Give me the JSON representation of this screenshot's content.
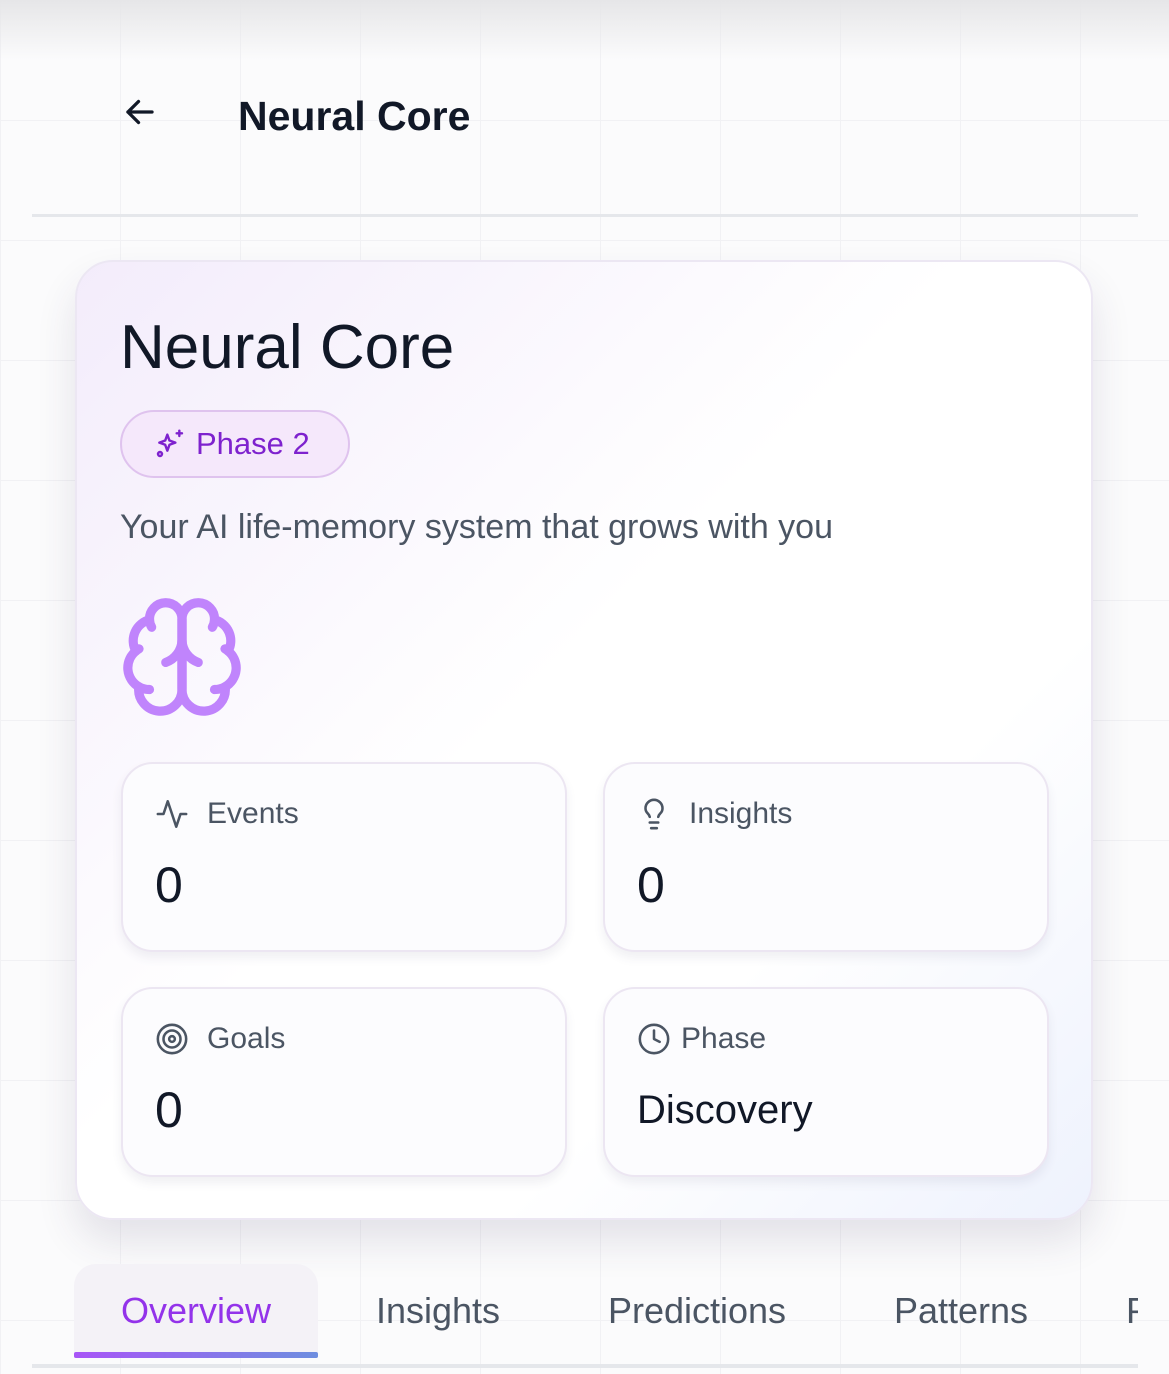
{
  "header": {
    "title": "Neural Core",
    "back_icon": "arrow-left-icon"
  },
  "hero": {
    "title": "Neural Core",
    "badge": {
      "icon": "sparkles-icon",
      "label": "Phase 2"
    },
    "description": "Your AI life-memory system that grows with you",
    "illustration_icon": "brain-icon"
  },
  "stats": [
    {
      "icon": "activity-icon",
      "label": "Events",
      "value": "0"
    },
    {
      "icon": "lightbulb-icon",
      "label": "Insights",
      "value": "0"
    },
    {
      "icon": "target-icon",
      "label": "Goals",
      "value": "0"
    },
    {
      "icon": "clock-icon",
      "label": "Phase",
      "value": "Discovery"
    }
  ],
  "tabs": [
    {
      "label": "Overview",
      "active": true
    },
    {
      "label": "Insights",
      "active": false
    },
    {
      "label": "Predictions",
      "active": false
    },
    {
      "label": "Patterns",
      "active": false
    },
    {
      "label": "P",
      "active": false
    }
  ],
  "colors": {
    "accent": "#9333ea",
    "brain": "#c084fc",
    "text_primary": "#111827",
    "text_secondary": "#4b5563"
  }
}
